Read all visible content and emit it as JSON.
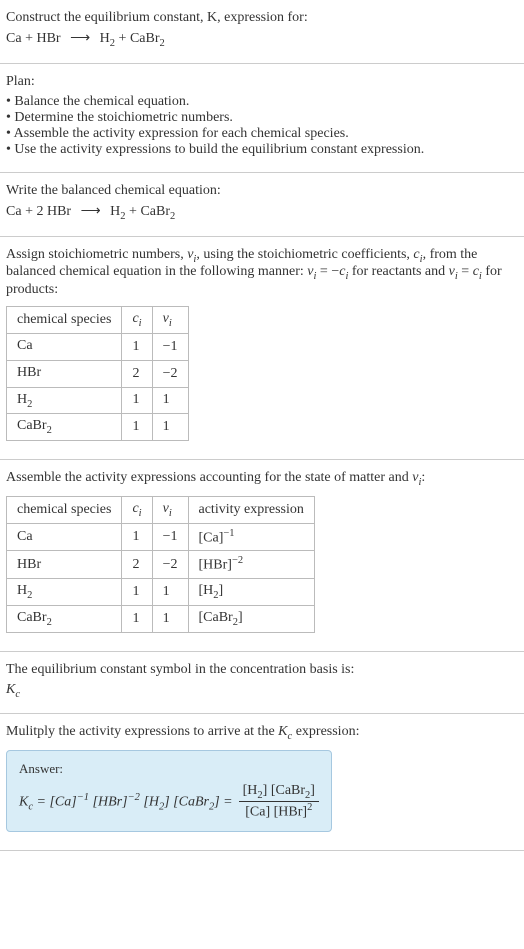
{
  "intro": {
    "prompt": "Construct the equilibrium constant, K, expression for:",
    "equation_lhs1": "Ca",
    "plus": " + ",
    "equation_lhs2": "HBr",
    "arrow": " ⟶ ",
    "equation_rhs1": "H",
    "equation_rhs1_sub": "2",
    "equation_rhs2": "CaBr",
    "equation_rhs2_sub": "2"
  },
  "plan": {
    "title": "Plan:",
    "items": [
      "Balance the chemical equation.",
      "Determine the stoichiometric numbers.",
      "Assemble the activity expression for each chemical species.",
      "Use the activity expressions to build the equilibrium constant expression."
    ]
  },
  "balanced": {
    "title": "Write the balanced chemical equation:",
    "lhs1": "Ca",
    "plus1": " + ",
    "coef2": "2",
    "lhs2": " HBr",
    "arrow": " ⟶ ",
    "rhs1": "H",
    "rhs1_sub": "2",
    "plus2": " + ",
    "rhs2": "CaBr",
    "rhs2_sub": "2"
  },
  "stoich": {
    "desc_a": "Assign stoichiometric numbers, ",
    "nu_i": "ν",
    "nu_i_sub": "i",
    "desc_b": ", using the stoichiometric coefficients, ",
    "c_i": "c",
    "c_i_sub": "i",
    "desc_c": ", from the balanced chemical equation in the following manner: ",
    "rel1": "ν",
    "rel1_sub": "i",
    "rel1_eq": " = −",
    "rel1_c": "c",
    "rel1_csub": "i",
    "desc_d": " for reactants and ",
    "rel2": "ν",
    "rel2_sub": "i",
    "rel2_eq": " = ",
    "rel2_c": "c",
    "rel2_csub": "i",
    "desc_e": " for products:",
    "headers": {
      "species": "chemical species",
      "ci": "c",
      "ci_sub": "i",
      "nui": "ν",
      "nui_sub": "i"
    },
    "rows": [
      {
        "species": "Ca",
        "sub": "",
        "ci": "1",
        "nui": "−1"
      },
      {
        "species": "HBr",
        "sub": "",
        "ci": "2",
        "nui": "−2"
      },
      {
        "species": "H",
        "sub": "2",
        "ci": "1",
        "nui": "1"
      },
      {
        "species": "CaBr",
        "sub": "2",
        "ci": "1",
        "nui": "1"
      }
    ]
  },
  "activity": {
    "desc_a": "Assemble the activity expressions accounting for the state of matter and ",
    "nu": "ν",
    "nu_sub": "i",
    "desc_b": ":",
    "headers": {
      "species": "chemical species",
      "ci": "c",
      "ci_sub": "i",
      "nui": "ν",
      "nui_sub": "i",
      "expr": "activity expression"
    },
    "rows": [
      {
        "species": "Ca",
        "sub": "",
        "ci": "1",
        "nui": "−1",
        "expr_base": "[Ca]",
        "expr_sup": "−1"
      },
      {
        "species": "HBr",
        "sub": "",
        "ci": "2",
        "nui": "−2",
        "expr_base": "[HBr]",
        "expr_sup": "−2"
      },
      {
        "species": "H",
        "sub": "2",
        "ci": "1",
        "nui": "1",
        "expr_base_pre": "[H",
        "expr_base_sub": "2",
        "expr_base_post": "]",
        "expr_sup": ""
      },
      {
        "species": "CaBr",
        "sub": "2",
        "ci": "1",
        "nui": "1",
        "expr_base_pre": "[CaBr",
        "expr_base_sub": "2",
        "expr_base_post": "]",
        "expr_sup": ""
      }
    ]
  },
  "symbol": {
    "desc": "The equilibrium constant symbol in the concentration basis is:",
    "K": "K",
    "K_sub": "c"
  },
  "multiply": {
    "desc_a": "Mulitply the activity expressions to arrive at the ",
    "K": "K",
    "K_sub": "c",
    "desc_b": " expression:"
  },
  "answer": {
    "label": "Answer:",
    "Kc": "K",
    "Kc_sub": "c",
    "eq": " = ",
    "t1": "[Ca]",
    "t1_sup": "−1",
    "sp": " ",
    "t2": "[HBr]",
    "t2_sup": "−2",
    "t3_pre": "[H",
    "t3_sub": "2",
    "t3_post": "]",
    "t4_pre": "[CaBr",
    "t4_sub": "2",
    "t4_post": "]",
    "eq2": " = ",
    "num_a_pre": "[H",
    "num_a_sub": "2",
    "num_a_post": "]",
    "num_b_pre": " [CaBr",
    "num_b_sub": "2",
    "num_b_post": "]",
    "den_a": "[Ca]",
    "den_b": " [HBr]",
    "den_b_sup": "2"
  },
  "chart_data": {
    "type": "table",
    "tables": [
      {
        "title": "Stoichiometric numbers",
        "columns": [
          "chemical species",
          "c_i",
          "ν_i"
        ],
        "rows": [
          [
            "Ca",
            1,
            -1
          ],
          [
            "HBr",
            2,
            -2
          ],
          [
            "H2",
            1,
            1
          ],
          [
            "CaBr2",
            1,
            1
          ]
        ]
      },
      {
        "title": "Activity expressions",
        "columns": [
          "chemical species",
          "c_i",
          "ν_i",
          "activity expression"
        ],
        "rows": [
          [
            "Ca",
            1,
            -1,
            "[Ca]^-1"
          ],
          [
            "HBr",
            2,
            -2,
            "[HBr]^-2"
          ],
          [
            "H2",
            1,
            1,
            "[H2]"
          ],
          [
            "CaBr2",
            1,
            1,
            "[CaBr2]"
          ]
        ]
      }
    ]
  }
}
